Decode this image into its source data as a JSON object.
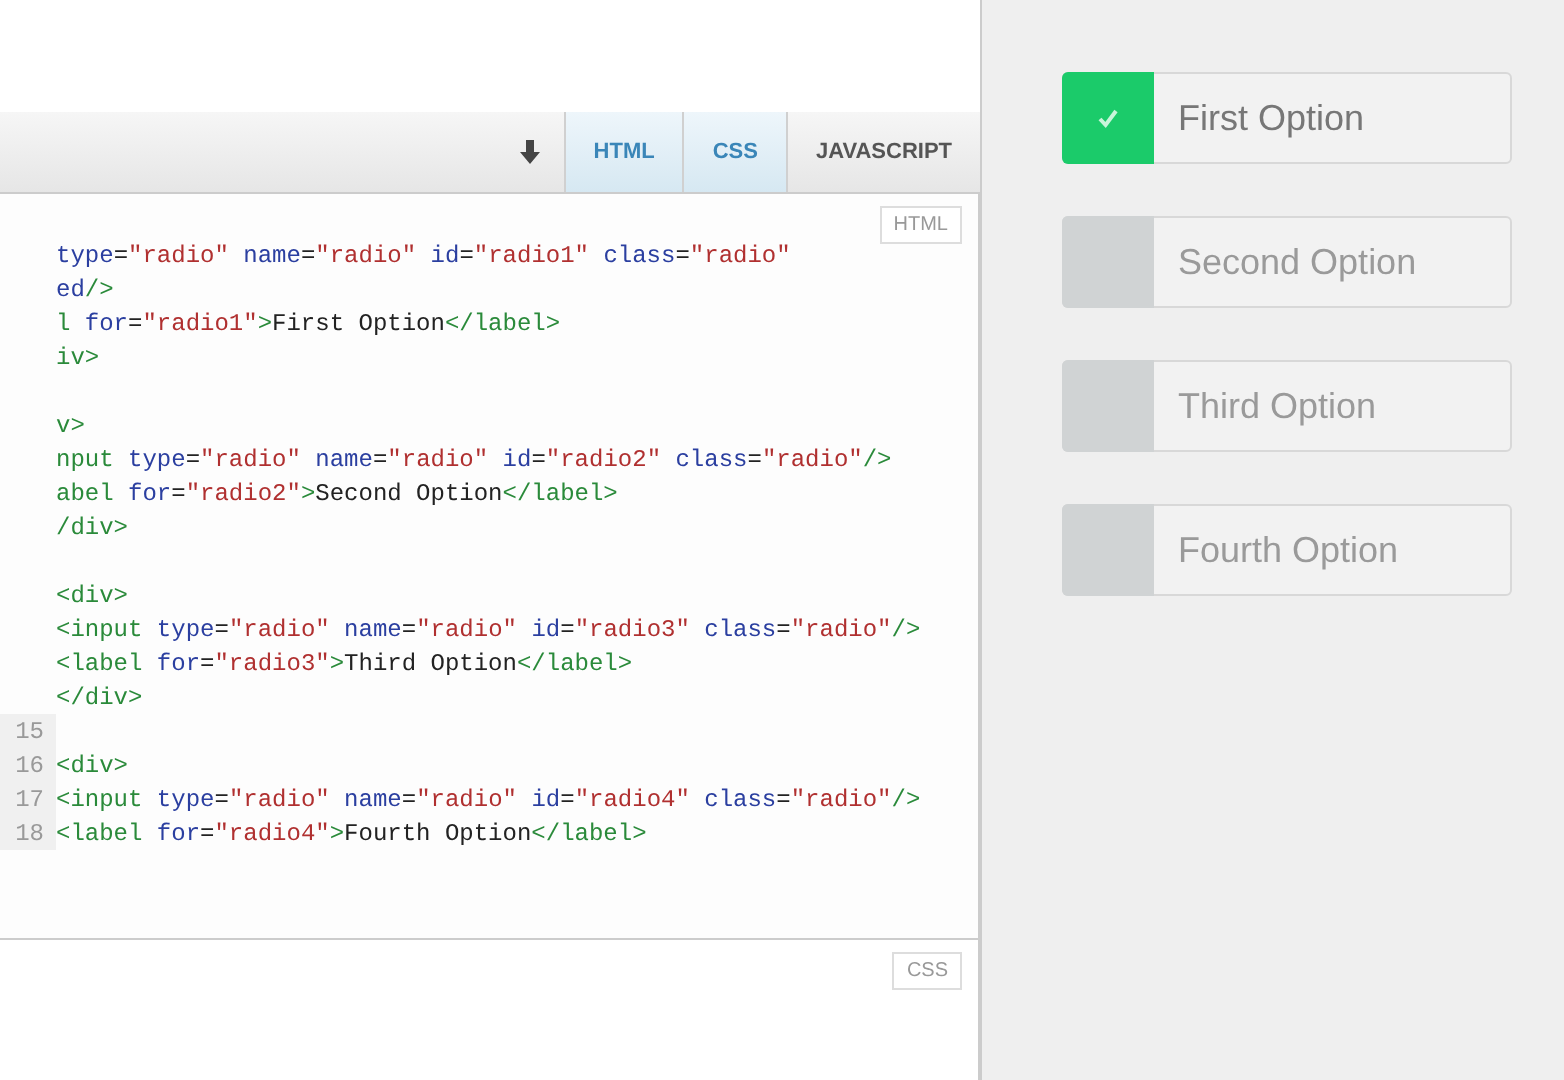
{
  "toolbar": {
    "tabs": [
      {
        "label": "HTML",
        "selected": true
      },
      {
        "label": "CSS",
        "selected": true
      },
      {
        "label": "JAVASCRIPT",
        "selected": false
      }
    ]
  },
  "html_pane": {
    "label": "HTML",
    "lines": [
      {
        "kind": "code",
        "tokens": [
          {
            "kind": "attr",
            "text": "type"
          },
          {
            "kind": "text",
            "text": "="
          },
          {
            "kind": "string",
            "text": "\"radio\""
          },
          {
            "kind": "attr",
            "text": " name"
          },
          {
            "kind": "text",
            "text": "="
          },
          {
            "kind": "string",
            "text": "\"radio\""
          },
          {
            "kind": "attr",
            "text": " id"
          },
          {
            "kind": "text",
            "text": "="
          },
          {
            "kind": "string",
            "text": "\"radio1\""
          },
          {
            "kind": "attr",
            "text": " class"
          },
          {
            "kind": "text",
            "text": "="
          },
          {
            "kind": "string",
            "text": "\"radio\""
          }
        ]
      },
      {
        "kind": "code",
        "tokens": [
          {
            "kind": "attr",
            "text": "ed"
          },
          {
            "kind": "tag",
            "text": "/>"
          }
        ]
      },
      {
        "kind": "code",
        "tokens": [
          {
            "kind": "tag",
            "text": "l"
          },
          {
            "kind": "attr",
            "text": " for"
          },
          {
            "kind": "text",
            "text": "="
          },
          {
            "kind": "string",
            "text": "\"radio1\""
          },
          {
            "kind": "tag",
            "text": ">"
          },
          {
            "kind": "text",
            "text": "First Option"
          },
          {
            "kind": "tag",
            "text": "</label>"
          }
        ]
      },
      {
        "kind": "code",
        "tokens": [
          {
            "kind": "tag",
            "text": "iv>"
          }
        ]
      },
      {
        "kind": "blank"
      },
      {
        "kind": "code",
        "tokens": [
          {
            "kind": "tag",
            "text": "v>"
          }
        ]
      },
      {
        "kind": "code",
        "tokens": [
          {
            "kind": "tag",
            "text": "nput"
          },
          {
            "kind": "attr",
            "text": " type"
          },
          {
            "kind": "text",
            "text": "="
          },
          {
            "kind": "string",
            "text": "\"radio\""
          },
          {
            "kind": "attr",
            "text": " name"
          },
          {
            "kind": "text",
            "text": "="
          },
          {
            "kind": "string",
            "text": "\"radio\""
          },
          {
            "kind": "attr",
            "text": " id"
          },
          {
            "kind": "text",
            "text": "="
          },
          {
            "kind": "string",
            "text": "\"radio2\""
          },
          {
            "kind": "attr",
            "text": " class"
          },
          {
            "kind": "text",
            "text": "="
          },
          {
            "kind": "string",
            "text": "\"radio\""
          },
          {
            "kind": "tag",
            "text": "/>"
          }
        ]
      },
      {
        "kind": "code",
        "tokens": [
          {
            "kind": "tag",
            "text": "abel"
          },
          {
            "kind": "attr",
            "text": " for"
          },
          {
            "kind": "text",
            "text": "="
          },
          {
            "kind": "string",
            "text": "\"radio2\""
          },
          {
            "kind": "tag",
            "text": ">"
          },
          {
            "kind": "text",
            "text": "Second Option"
          },
          {
            "kind": "tag",
            "text": "</label>"
          }
        ]
      },
      {
        "kind": "code",
        "tokens": [
          {
            "kind": "tag",
            "text": "/div>"
          }
        ]
      },
      {
        "kind": "blank"
      },
      {
        "kind": "code",
        "tokens": [
          {
            "kind": "tag",
            "text": "<div>"
          }
        ]
      },
      {
        "kind": "code",
        "tokens": [
          {
            "kind": "tag",
            "text": "<input"
          },
          {
            "kind": "attr",
            "text": " type"
          },
          {
            "kind": "text",
            "text": "="
          },
          {
            "kind": "string",
            "text": "\"radio\""
          },
          {
            "kind": "attr",
            "text": " name"
          },
          {
            "kind": "text",
            "text": "="
          },
          {
            "kind": "string",
            "text": "\"radio\""
          },
          {
            "kind": "attr",
            "text": " id"
          },
          {
            "kind": "text",
            "text": "="
          },
          {
            "kind": "string",
            "text": "\"radio3\""
          },
          {
            "kind": "attr",
            "text": " class"
          },
          {
            "kind": "text",
            "text": "="
          },
          {
            "kind": "string",
            "text": "\"radio\""
          },
          {
            "kind": "tag",
            "text": "/>"
          }
        ]
      },
      {
        "kind": "code",
        "tokens": [
          {
            "kind": "tag",
            "text": "<label"
          },
          {
            "kind": "attr",
            "text": " for"
          },
          {
            "kind": "text",
            "text": "="
          },
          {
            "kind": "string",
            "text": "\"radio3\""
          },
          {
            "kind": "tag",
            "text": ">"
          },
          {
            "kind": "text",
            "text": "Third Option"
          },
          {
            "kind": "tag",
            "text": "</label>"
          }
        ]
      },
      {
        "kind": "code",
        "tokens": [
          {
            "kind": "tag",
            "text": "</div>"
          }
        ]
      },
      {
        "kind": "blank",
        "number": "15"
      },
      {
        "kind": "code",
        "number": "16",
        "tokens": [
          {
            "kind": "tag",
            "text": "<div>"
          }
        ]
      },
      {
        "kind": "code",
        "number": "17",
        "tokens": [
          {
            "kind": "tag",
            "text": "<input"
          },
          {
            "kind": "attr",
            "text": " type"
          },
          {
            "kind": "text",
            "text": "="
          },
          {
            "kind": "string",
            "text": "\"radio\""
          },
          {
            "kind": "attr",
            "text": " name"
          },
          {
            "kind": "text",
            "text": "="
          },
          {
            "kind": "string",
            "text": "\"radio\""
          },
          {
            "kind": "attr",
            "text": " id"
          },
          {
            "kind": "text",
            "text": "="
          },
          {
            "kind": "string",
            "text": "\"radio4\""
          },
          {
            "kind": "attr",
            "text": " class"
          },
          {
            "kind": "text",
            "text": "="
          },
          {
            "kind": "string",
            "text": "\"radio\""
          },
          {
            "kind": "tag",
            "text": "/>"
          }
        ]
      },
      {
        "kind": "code",
        "number": "18",
        "tokens": [
          {
            "kind": "tag",
            "text": "<label"
          },
          {
            "kind": "attr",
            "text": " for"
          },
          {
            "kind": "text",
            "text": "="
          },
          {
            "kind": "string",
            "text": "\"radio4\""
          },
          {
            "kind": "tag",
            "text": ">"
          },
          {
            "kind": "text",
            "text": "Fourth Option"
          },
          {
            "kind": "tag",
            "text": "</label>"
          }
        ]
      }
    ]
  },
  "css_pane": {
    "label": "CSS"
  },
  "preview": {
    "options": [
      {
        "label": "First Option",
        "checked": true
      },
      {
        "label": "Second Option",
        "checked": false
      },
      {
        "label": "Third Option",
        "checked": false
      },
      {
        "label": "Fourth Option",
        "checked": false
      }
    ]
  }
}
